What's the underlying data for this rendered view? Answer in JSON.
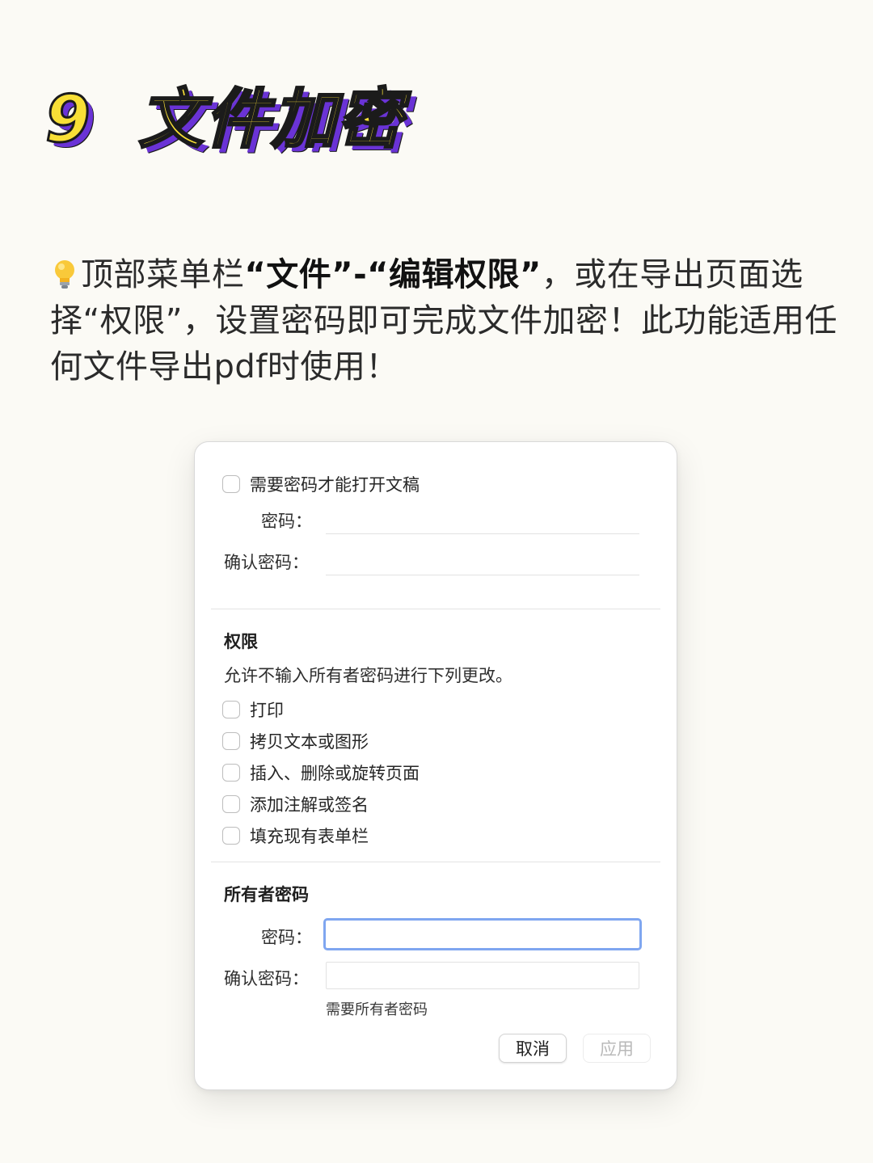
{
  "headline": {
    "number": "9",
    "title": "文件加密"
  },
  "intro": {
    "part1": "顶部菜单栏",
    "bold": "“文件”-“编辑权限”",
    "part2": "，或在导出页面选择“权限”，设置密码即可完成文件加密！此功能适用任何文件导出pdf时使用！"
  },
  "dialog": {
    "open_required_label": "需要密码才能打开文稿",
    "password_label": "密码：",
    "confirm_label": "确认密码：",
    "permissions": {
      "title": "权限",
      "description": "允许不输入所有者密码进行下列更改。",
      "items": [
        {
          "label": "打印"
        },
        {
          "label": "拷贝文本或图形"
        },
        {
          "label": "插入、删除或旋转页面"
        },
        {
          "label": "添加注解或签名"
        },
        {
          "label": "填充现有表单栏"
        }
      ]
    },
    "owner": {
      "title": "所有者密码",
      "password_label": "密码：",
      "confirm_label": "确认密码：",
      "hint": "需要所有者密码"
    },
    "buttons": {
      "cancel": "取消",
      "apply": "应用"
    }
  }
}
